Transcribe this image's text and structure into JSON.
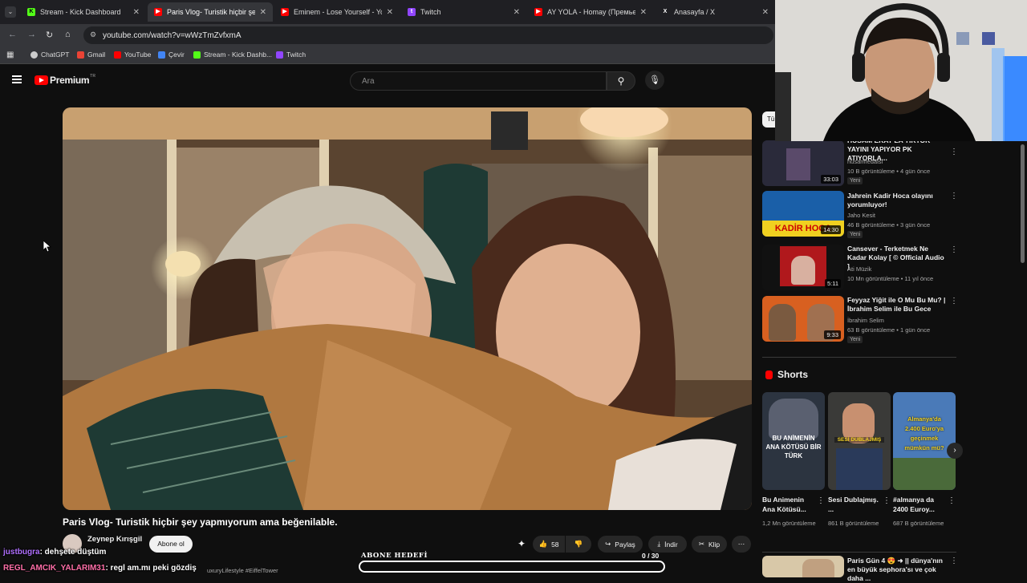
{
  "browser": {
    "tabs": [
      {
        "label": "Stream - Kick Dashboard",
        "fav_color": "#53fc18",
        "fav_glyph": "K"
      },
      {
        "label": "Paris Vlog- Turistik hiçbir şey ya",
        "fav_color": "#ff0000",
        "fav_glyph": "▶"
      },
      {
        "label": "Eminem - Lose Yourself - YouT",
        "fav_color": "#ff0000",
        "fav_glyph": "▶"
      },
      {
        "label": "Twitch",
        "fav_color": "#9146ff",
        "fav_glyph": "t"
      },
      {
        "label": "AY YOLA - Homay (Премьера",
        "fav_color": "#ff0000",
        "fav_glyph": "▶"
      },
      {
        "label": "Anasayfa / X",
        "fav_color": "#ffffff",
        "fav_glyph": "X"
      }
    ],
    "url": "youtube.com/watch?v=wWzTmZvfxmA",
    "bookmarks": [
      {
        "label": "ChatGPT",
        "color": "#cccccc"
      },
      {
        "label": "Gmail",
        "color": "#ea4335"
      },
      {
        "label": "YouTube",
        "color": "#ff0000"
      },
      {
        "label": "Çevir",
        "color": "#4285f4"
      },
      {
        "label": "Stream - Kick Dashb...",
        "color": "#53fc18"
      },
      {
        "label": "Twitch",
        "color": "#9146ff"
      }
    ]
  },
  "youtube": {
    "logo": "Premium",
    "logo_sup": "TR",
    "search_placeholder": "Ara",
    "video": {
      "title": "Paris Vlog- Turistik hiçbir şey yapmıyorum ama beğenilable.",
      "channel": "Zeynep Kırışgil",
      "subscribe": "Abone ol",
      "likes": "58",
      "share": "Paylaş",
      "download": "İndir",
      "clip": "Klip",
      "hashtags": "uxuryLifestyle #EiffelTower"
    },
    "filter_chip": "Tü",
    "related": [
      {
        "title": "HÜSAM EKAT LA TIKTOK YAYINI YAPIYOR PK ATIYORLA...",
        "channel": "husamfedaisi",
        "meta": "10 B görüntüleme • 4 gün önce",
        "badge": "Yeni",
        "duration": "33:03",
        "thumb_color": "#2a2a3a"
      },
      {
        "title": "Jahrein Kadir Hoca olayını yorumluyor!",
        "channel": "Jaho Kesit",
        "meta": "46 B görüntüleme • 3 gün önce",
        "badge": "Yeni",
        "duration": "14:30",
        "thumb_color": "#1a5fa8"
      },
      {
        "title": "Cansever - Terketmek Ne Kadar Kolay [ © Official Audio ]",
        "channel": "Ati Müzik",
        "meta": "10 Mn görüntüleme • 11 yıl önce",
        "badge": "",
        "duration": "5:11",
        "thumb_color": "#b0181c"
      },
      {
        "title": "Feyyaz Yiğit ile O Mu Bu Mu? | İbrahim Selim ile Bu Gece",
        "channel": "İbrahim Selim",
        "meta": "63 B görüntüleme • 1 gün önce",
        "badge": "Yeni",
        "duration": "9:33",
        "thumb_color": "#d86020"
      }
    ],
    "shorts_heading": "Shorts",
    "shorts": [
      {
        "title": "Bu Animenin Ana Kötüsü...",
        "views": "1,2 Mn görüntüleme",
        "overlay": "BU ANİMENİN ANA KÖTÜSÜ BİR TÜRK",
        "color": "#2c3440"
      },
      {
        "title": "Sesi Dublajmış. ...",
        "views": "861 B görüntüleme",
        "overlay": "SESİ DUBLAJMIŞ",
        "color": "#3a3a38"
      },
      {
        "title": "#almanya da 2400 Euroy...",
        "views": "687 B görüntüleme",
        "overlay": "Almanya'da 2.400 Euro'ya geçinmek mümkün mü?",
        "color": "#4a7ab8"
      }
    ],
    "bottom_item": {
      "title": "Paris Gün 4 😍 ➜ || dünya'nın en büyük sephora'sı ve çok daha ..."
    }
  },
  "overlay": {
    "chat": [
      {
        "user": "justbugra",
        "message": ": dehşete düştüm",
        "user_color": "#b070ff"
      },
      {
        "user": "REGL_AMCIK_YALARIM31",
        "message": ": regl am.mı peki gözdiş",
        "user_color": "#ff6fa8"
      }
    ],
    "goal_title": "ABONE HEDEFİ",
    "goal_count": "0  / 30",
    "goal_progress": 0
  }
}
